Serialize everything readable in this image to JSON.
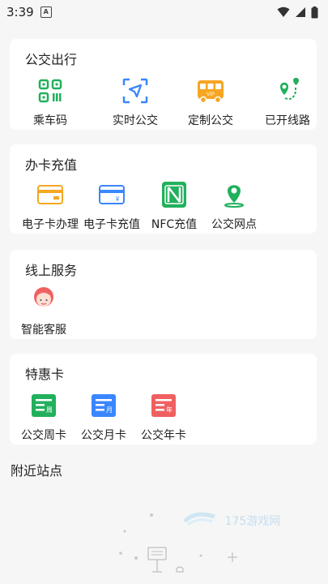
{
  "status_bar": {
    "time": "3:39",
    "notification_glyph": "A"
  },
  "sections": {
    "bus_travel": {
      "title": "公交出行",
      "items": [
        "乘车码",
        "实时公交",
        "定制公交",
        "已开线路"
      ]
    },
    "card_recharge": {
      "title": "办卡充值",
      "items": [
        "电子卡办理",
        "电子卡充值",
        "NFC充值",
        "公交网点"
      ]
    },
    "online_service": {
      "title": "线上服务",
      "items": [
        "智能客服"
      ]
    },
    "special_cards": {
      "title": "特惠卡",
      "items": [
        "公交周卡",
        "公交月卡",
        "公交年卡"
      ],
      "badges": [
        "周",
        "月",
        "年"
      ]
    }
  },
  "nearby": {
    "title": "附近站点"
  },
  "watermark": {
    "text": "175游戏网"
  },
  "colors": {
    "green": "#21b05c",
    "blue": "#3a86ff",
    "orange": "#f5a623",
    "red": "#f06060"
  }
}
